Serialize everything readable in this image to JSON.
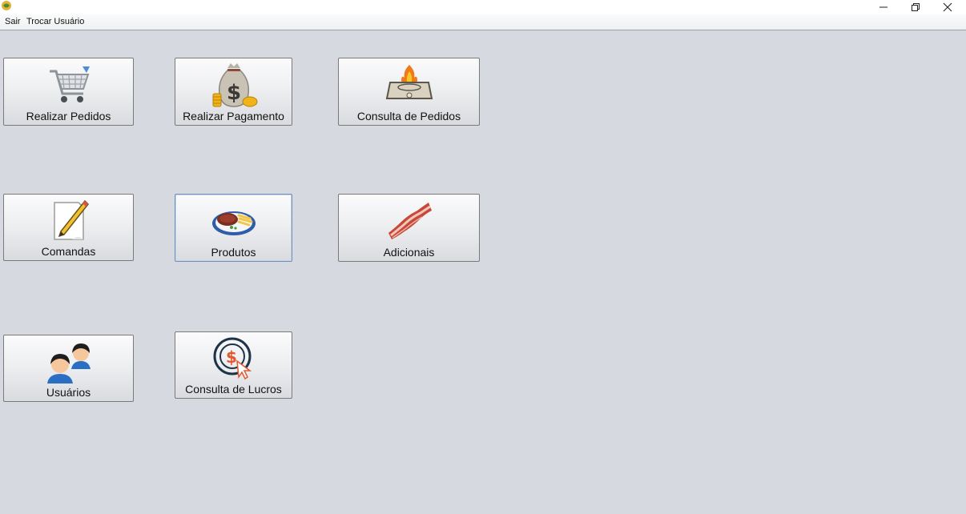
{
  "window": {
    "app_icon": "java-app-icon",
    "controls": [
      "minimize-icon",
      "restore-icon",
      "close-icon"
    ]
  },
  "menu": {
    "items": [
      "Sair",
      "Trocar Usuário"
    ]
  },
  "tiles": [
    {
      "label": "Realizar Pedidos",
      "icon": "shopping-cart-icon"
    },
    {
      "label": "Realizar Pagamento",
      "icon": "money-bag-icon"
    },
    {
      "label": "Consulta de Pedidos",
      "icon": "stove-fire-icon"
    },
    {
      "label": "Comandas",
      "icon": "pencil-paper-icon"
    },
    {
      "label": "Produtos",
      "icon": "steak-plate-icon",
      "state": "focused"
    },
    {
      "label": "Adicionais",
      "icon": "bacon-icon"
    },
    {
      "label": "Usuários",
      "icon": "users-icon"
    },
    {
      "label": "Consulta de Lucros",
      "icon": "profit-click-icon"
    }
  ]
}
